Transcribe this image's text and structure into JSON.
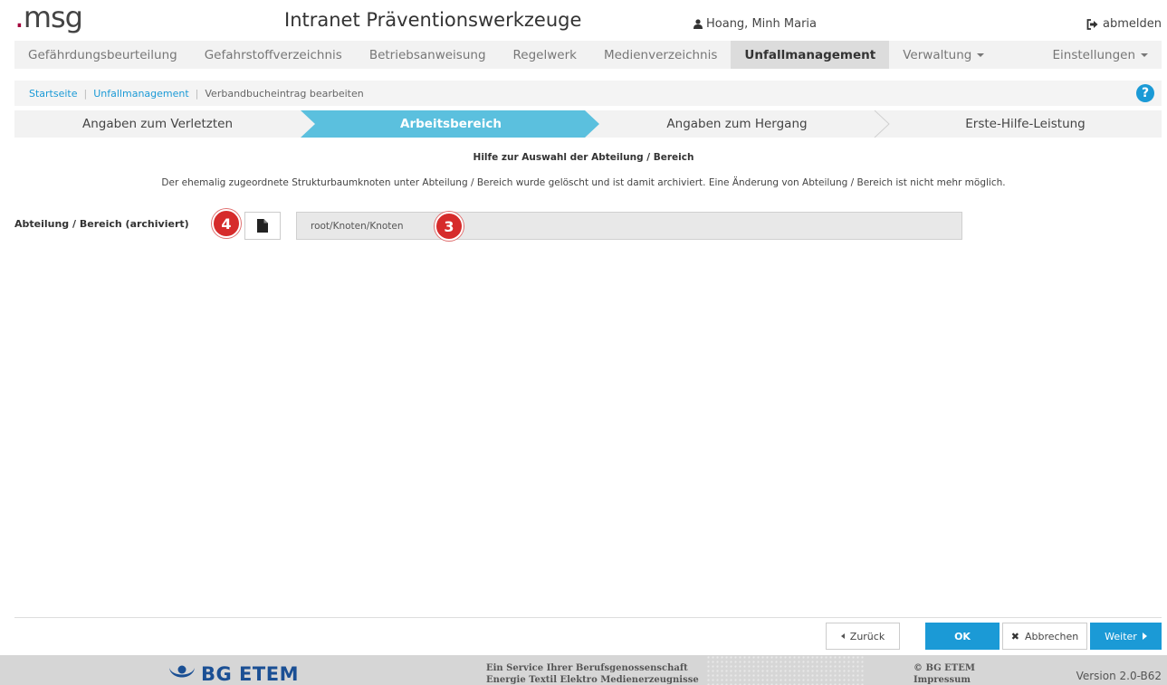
{
  "header": {
    "logo": ".msg",
    "title": "Intranet Präventionswerkzeuge",
    "user": "Hoang, Minh Maria",
    "logout": "abmelden"
  },
  "nav": {
    "items": [
      {
        "label": "Gefährdungsbeurteilung"
      },
      {
        "label": "Gefahrstoffverzeichnis"
      },
      {
        "label": "Betriebsanweisung"
      },
      {
        "label": "Regelwerk"
      },
      {
        "label": "Medienverzeichnis"
      },
      {
        "label": "Unfallmanagement",
        "active": true
      },
      {
        "label": "Verwaltung",
        "dropdown": true
      },
      {
        "label": "Einstellungen",
        "dropdown": true
      }
    ]
  },
  "breadcrumb": {
    "items": [
      "Startseite",
      "Unfallmanagement",
      "Verbandbucheintrag bearbeiten"
    ],
    "help_icon": "?"
  },
  "wizard": {
    "steps": [
      {
        "label": "Angaben zum Verletzten"
      },
      {
        "label": "Arbeitsbereich",
        "active": true
      },
      {
        "label": "Angaben zum Hergang"
      },
      {
        "label": "Erste-Hilfe-Leistung"
      }
    ],
    "active_color": "#5bc0de"
  },
  "content": {
    "hint_title": "Hilfe zur Auswahl der Abteilung / Bereich",
    "hint_text": "Der ehemalig zugeordnete Strukturbaumknoten unter Abteilung / Bereich wurde gelöscht und ist damit archiviert. Eine Änderung von Abteilung / Bereich ist nicht mehr möglich.",
    "field_label": "Abteilung / Bereich (archiviert)",
    "field_value": "root/Knoten/Knoten",
    "badges": [
      "4",
      "3"
    ],
    "file_icon": "document-icon"
  },
  "actions": {
    "back": "Zurück",
    "ok": "OK",
    "cancel": "Abbrechen",
    "next": "Weiter"
  },
  "footer": {
    "logo_text": "BG ETEM",
    "service_line1": "Ein Service Ihrer Berufsgenossenschaft",
    "service_line2": "Energie Textil Elektro Medienerzeugnisse",
    "copyright": "© BG ETEM",
    "impressum": "Impressum",
    "version": "Version 2.0-B62"
  },
  "colors": {
    "accent": "#1b9ad6",
    "badge": "#d62b2b",
    "logo_dot": "#a4003c",
    "footer_logo": "#1a4f94"
  }
}
